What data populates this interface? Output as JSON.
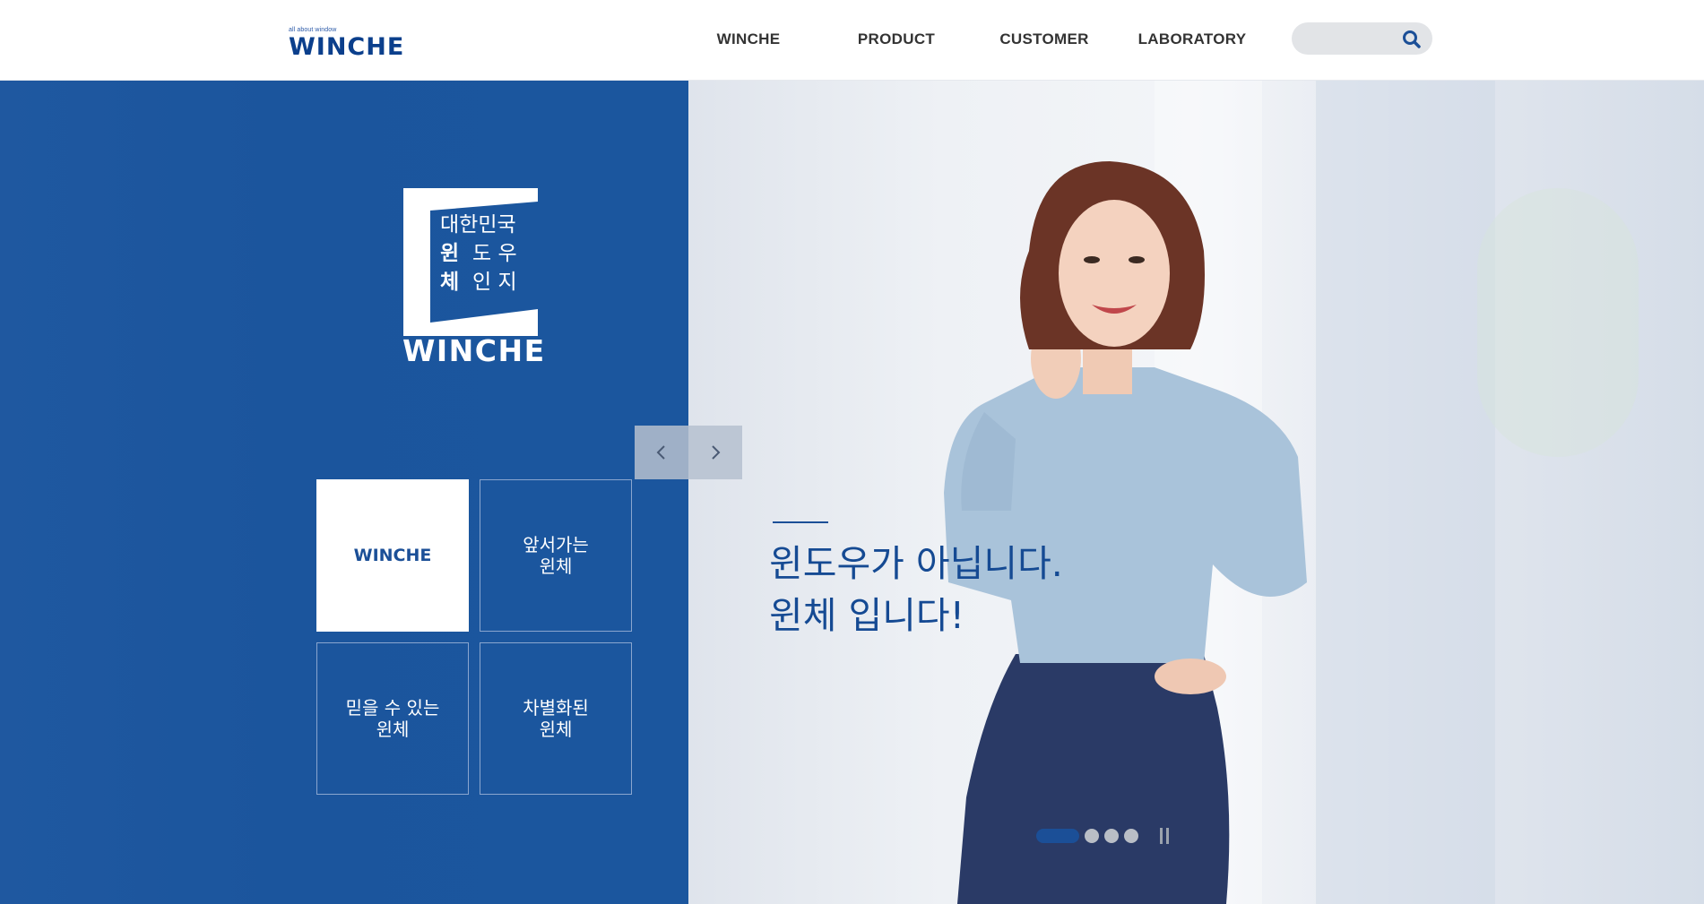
{
  "header": {
    "logo": {
      "tagline": "all about window",
      "wordmark": "WINCHE"
    },
    "nav": [
      {
        "label": "WINCHE"
      },
      {
        "label": "PRODUCT"
      },
      {
        "label": "CUSTOMER"
      },
      {
        "label": "LABORATORY"
      }
    ],
    "search": {
      "value": "",
      "icon": "search-icon"
    }
  },
  "hero": {
    "badge": {
      "line1": "대한민국",
      "line2_bold": "윈",
      "line2": "도 우",
      "line3_bold": "체",
      "line3": "인 지",
      "wordmark": "WINCHE"
    },
    "prev_icon": "chevron-left-icon",
    "next_icon": "chevron-right-icon",
    "tiles": [
      {
        "label": "WINCHE",
        "active": true
      },
      {
        "label": "앞서가는\n윈체",
        "active": false
      },
      {
        "label": "믿을 수 있는\n윈체",
        "active": false
      },
      {
        "label": "차별화된\n윈체",
        "active": false
      }
    ],
    "headline": "윈도우가 아닙니다.\n윈체 입니다!",
    "pager": {
      "count": 4,
      "active_index": 0,
      "pause_icon": "pause-icon"
    }
  },
  "colors": {
    "brand_blue": "#1b559d",
    "text_blue": "#154a93"
  }
}
